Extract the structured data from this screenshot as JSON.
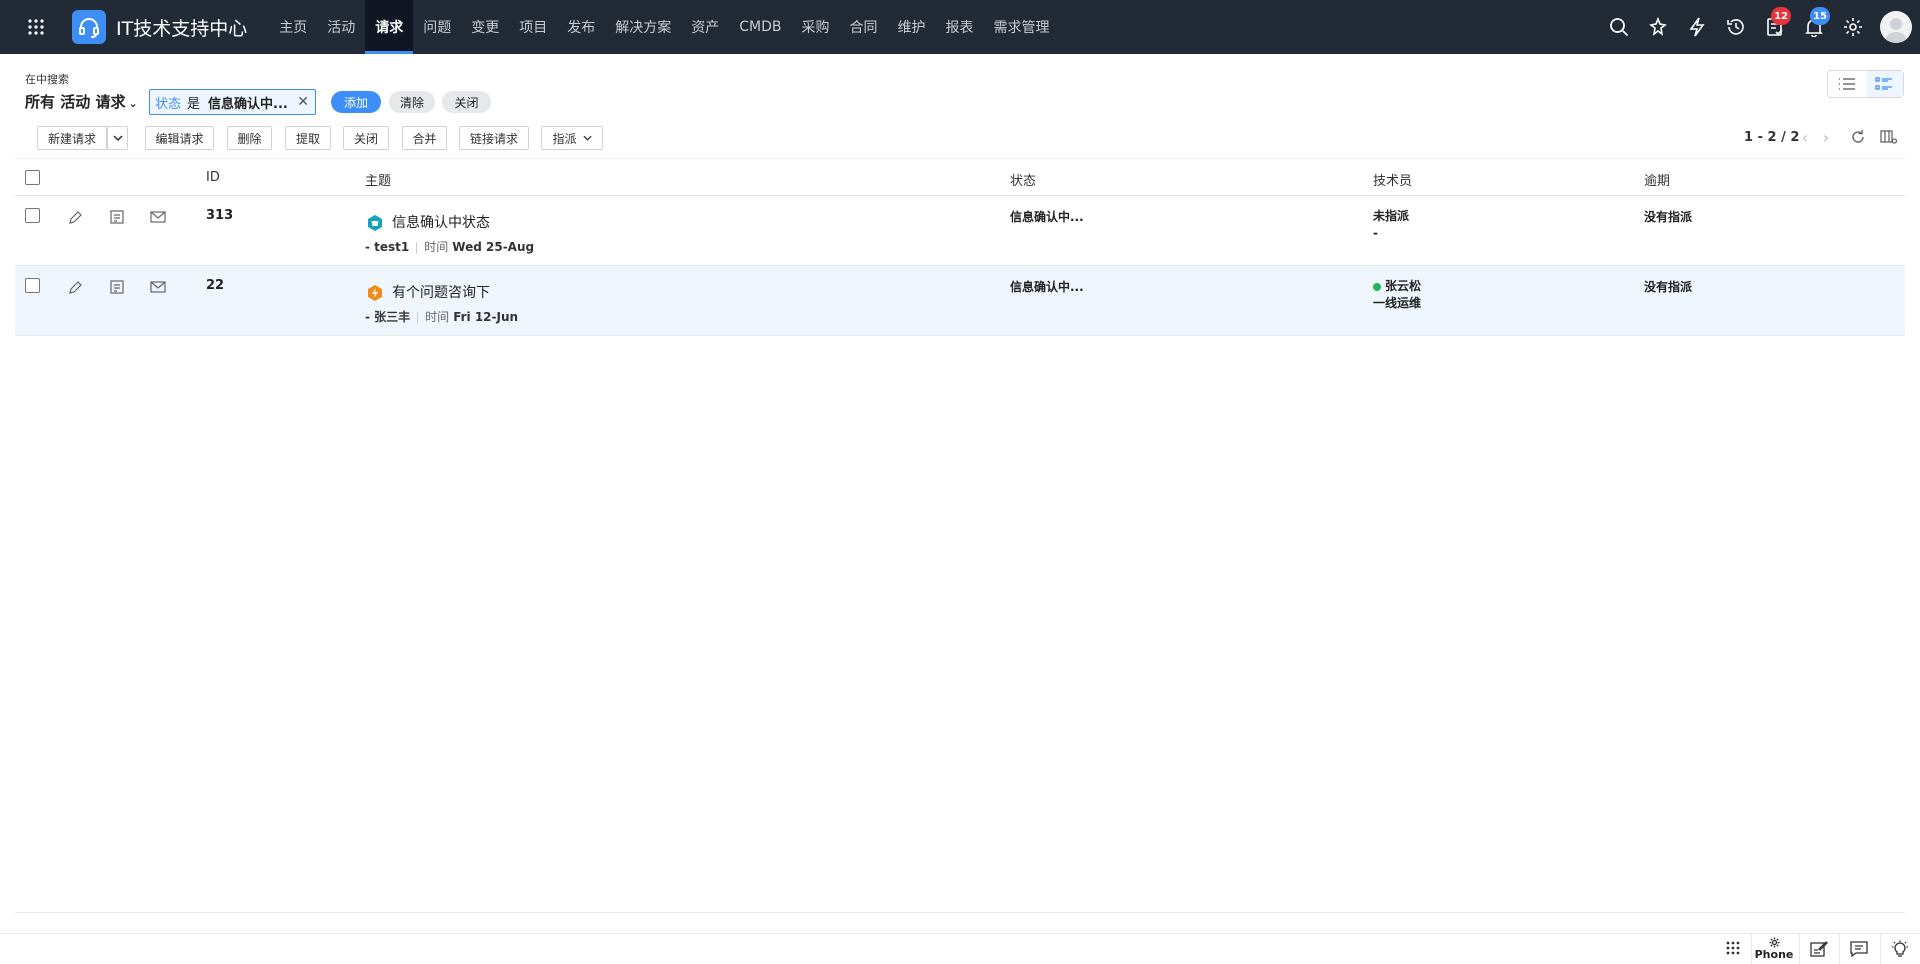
{
  "header": {
    "app_title": "IT技术支持中心",
    "nav": [
      "主页",
      "活动",
      "请求",
      "问题",
      "变更",
      "项目",
      "发布",
      "解决方案",
      "资产",
      "CMDB",
      "采购",
      "合同",
      "维护",
      "报表",
      "需求管理"
    ],
    "active_nav": "请求",
    "badges": {
      "tasks": "12",
      "notifications": "15"
    }
  },
  "filter": {
    "search_in": "在中搜索",
    "view": "所有 活动 请求",
    "chip": {
      "key": "状态",
      "op": "是",
      "value": "信息确认中..."
    },
    "add": "添加",
    "clear": "清除",
    "close": "关闭"
  },
  "toolbar": {
    "new_request": "新建请求",
    "edit_request": "编辑请求",
    "delete": "删除",
    "pickup": "提取",
    "close": "关闭",
    "merge": "合并",
    "link_request": "链接请求",
    "assign": "指派",
    "pager": "1 - 2 / 2"
  },
  "table": {
    "headers": {
      "id": "ID",
      "subject": "主题",
      "status": "状态",
      "technician": "技术员",
      "due": "逾期"
    },
    "rows": [
      {
        "id": "313",
        "subject": "信息确认中状态",
        "requester": "- test1",
        "time_label": "时间",
        "time": "Wed 25-Aug",
        "status": "信息确认中...",
        "technician": "未指派",
        "group": "-",
        "due": "没有指派",
        "icon": "service-request-icon",
        "icon_color": "#14a3b8"
      },
      {
        "id": "22",
        "subject": "有个问题咨询下",
        "requester": "- 张三丰",
        "time_label": "时间",
        "time": "Fri 12-Jun",
        "status": "信息确认中...",
        "technician": "张云松",
        "group": "一线运维",
        "due": "没有指派",
        "icon": "incident-icon",
        "icon_color": "#f08c1e"
      }
    ]
  },
  "footer": {
    "phone": "Phone"
  },
  "colors": {
    "topbar": "#222a35",
    "accent": "#3e8ef7",
    "badge_red": "#e8323c",
    "online": "#22b455"
  }
}
